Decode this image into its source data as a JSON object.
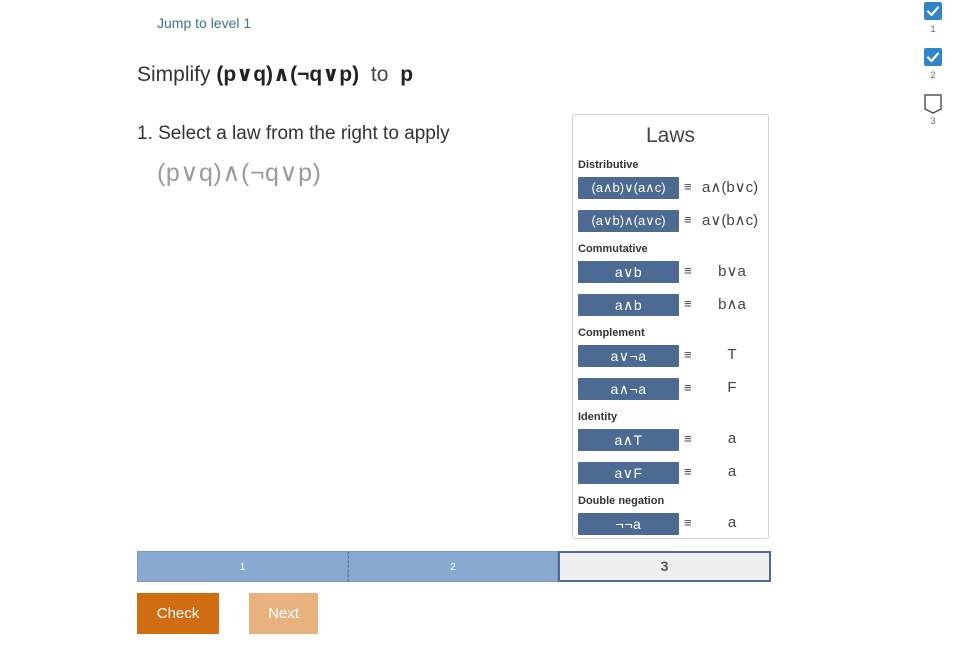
{
  "jump_link": "Jump to level 1",
  "title": {
    "prefix": "Simplify",
    "from_expr": "(p∨q)∧(¬q∨p)",
    "to_word": "to",
    "to_expr": "p"
  },
  "step": {
    "instruction": "1. Select a law from the right to apply",
    "expression": "(p∨q)∧(¬q∨p)"
  },
  "laws": {
    "title": "Laws",
    "equiv": "≡",
    "categories": [
      {
        "name": "Distributive",
        "rows": [
          {
            "lhs": "(a∧b)∨(a∧c)",
            "rhs": "a∧(b∨c)"
          },
          {
            "lhs": "(a∨b)∧(a∨c)",
            "rhs": "a∨(b∧c)"
          }
        ]
      },
      {
        "name": "Commutative",
        "rows": [
          {
            "lhs": "a∨b",
            "rhs": "b∨a"
          },
          {
            "lhs": "a∧b",
            "rhs": "b∧a"
          }
        ]
      },
      {
        "name": "Complement",
        "rows": [
          {
            "lhs": "a∨¬a",
            "rhs": "T"
          },
          {
            "lhs": "a∧¬a",
            "rhs": "F"
          }
        ]
      },
      {
        "name": "Identity",
        "rows": [
          {
            "lhs": "a∧T",
            "rhs": "a"
          },
          {
            "lhs": "a∨F",
            "rhs": "a"
          }
        ]
      },
      {
        "name": "Double negation",
        "rows": [
          {
            "lhs": "¬¬a",
            "rhs": "a"
          }
        ]
      }
    ]
  },
  "progress": {
    "segments": [
      "1",
      "2",
      "3"
    ],
    "current": 3
  },
  "buttons": {
    "check": "Check",
    "next": "Next"
  },
  "levels": [
    {
      "num": "1",
      "completed": true
    },
    {
      "num": "2",
      "completed": true
    },
    {
      "num": "3",
      "completed": false
    }
  ],
  "colors": {
    "accent": "#4c6a92",
    "check": "#d06d13",
    "next_disabled": "#e8b27f",
    "level_done": "#2f86c8"
  }
}
